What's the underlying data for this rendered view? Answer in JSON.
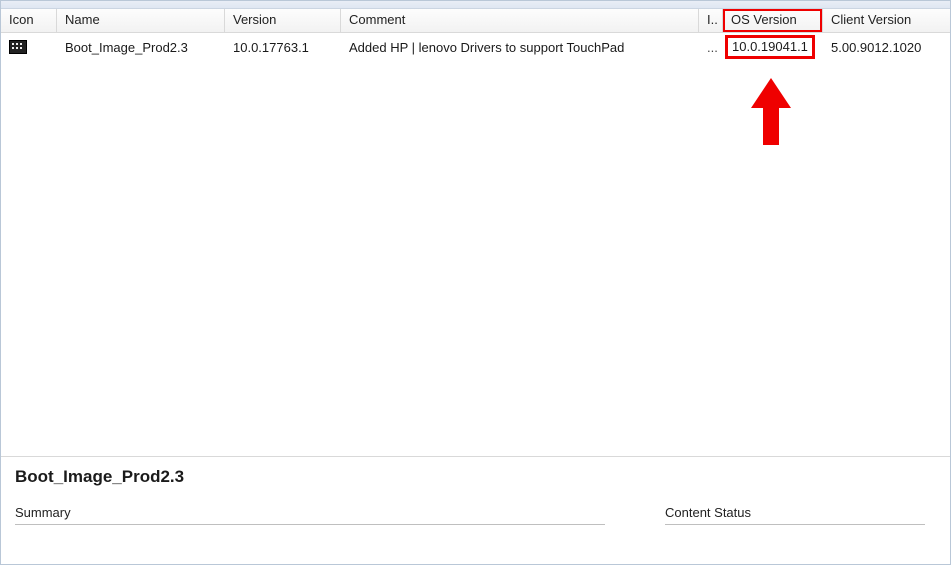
{
  "columns": {
    "icon": "Icon",
    "name": "Name",
    "version": "Version",
    "comment": "Comment",
    "image": "I..",
    "os_version": "OS Version",
    "client_version": "Client Version"
  },
  "rows": [
    {
      "name": "Boot_Image_Prod2.3",
      "version": "10.0.17763.1",
      "comment": "Added HP | lenovo Drivers to support TouchPad",
      "image": "...",
      "os_version": "10.0.19041.1",
      "client_version": "5.00.9012.1020"
    }
  ],
  "detail": {
    "title": "Boot_Image_Prod2.3",
    "summary_header": "Summary",
    "content_header": "Content Status"
  },
  "annotation": {
    "highlight_column": "os_version",
    "highlight_color": "#ef0000"
  }
}
